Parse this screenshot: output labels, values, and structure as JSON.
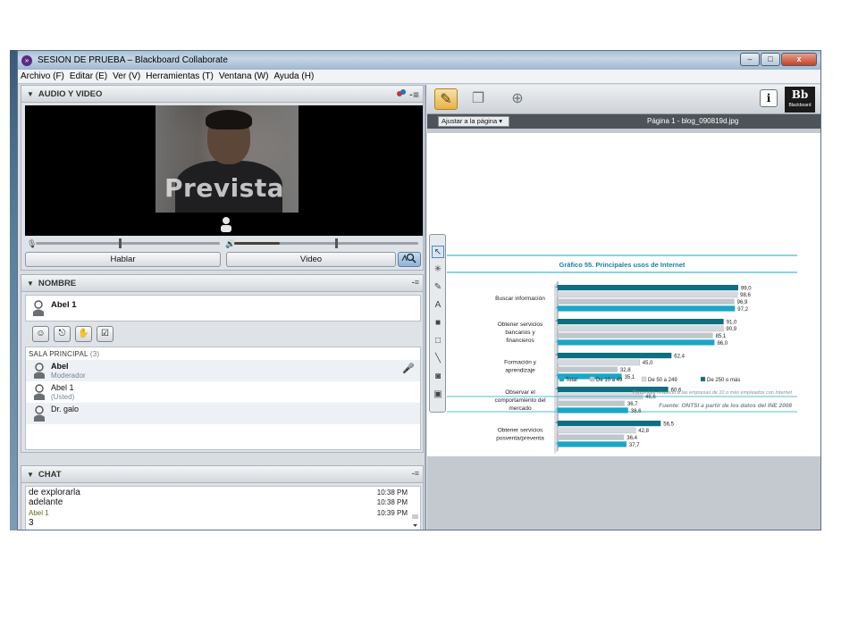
{
  "window": {
    "title": "SESION DE PRUEBA – Blackboard Collaborate",
    "controls": [
      "–",
      "□",
      "x"
    ]
  },
  "menu": [
    "Archivo (F)",
    "Editar (E)",
    "Ver (V)",
    "Herramientas (T)",
    "Ventana (W)",
    "Ayuda (H)"
  ],
  "audio_video": {
    "header": "AUDIO Y VIDEO",
    "overlay_text": "Prevista",
    "talk_button": "Hablar",
    "video_button": "Video",
    "mic_level": 0.45,
    "speaker_level": 0.55
  },
  "names": {
    "header": "NOMBRE",
    "me": "Abel 1",
    "room_label": "SALA PRINCIPAL",
    "room_count": "(3)",
    "participants": [
      {
        "name": "Abel",
        "status": "Moderador"
      },
      {
        "name": "Abel 1",
        "status": "(Usted)"
      },
      {
        "name": "Dr. galo",
        "status": ""
      }
    ]
  },
  "chat": {
    "header": "CHAT",
    "lines": [
      {
        "text": "de explorarla",
        "time": "10:38 PM"
      },
      {
        "text": "adelante",
        "time": "10:38 PM"
      },
      {
        "author": "Abel 1",
        "text": "3",
        "time": "10:39 PM"
      }
    ]
  },
  "whiteboard": {
    "fit_label": "Ajustar a la página",
    "page_label": "Página 1 - blog_090819d.jpg",
    "bb_text": "Bb",
    "bb_word": "Blackboard",
    "info_label": "i"
  },
  "colors": {
    "accent": "#e7b24a",
    "series": [
      "#1aa7c7",
      "#bfc6cc",
      "#e4eef3",
      "#0d6f80"
    ]
  },
  "chart_data": {
    "type": "bar",
    "orientation": "horizontal",
    "title": "Gráfico 55. Principales usos de Internet",
    "categories": [
      "Buscar información",
      "Obtener servicios bancarios y financieros",
      "Formación y aprendizaje",
      "Observar el comportamiento del mercado",
      "Obtener servicios posventa/preventa"
    ],
    "category_lines": [
      [
        "Buscar información"
      ],
      [
        "Obtener servicios",
        "bancarios y",
        "financieros"
      ],
      [
        "Formación y",
        "aprendizaje"
      ],
      [
        "Observar el",
        "comportamiento del",
        "mercado"
      ],
      [
        "Obtener servicios",
        "posventa/preventa"
      ]
    ],
    "series": [
      {
        "name": "De 250 o más",
        "values": [
          99.0,
          91.0,
          62.4,
          60.6,
          56.5
        ]
      },
      {
        "name": "De 50 a 249",
        "values": [
          98.6,
          90.9,
          45.0,
          46.6,
          42.8
        ]
      },
      {
        "name": "De 10 a 49",
        "values": [
          96.9,
          85.1,
          32.8,
          36.7,
          36.4
        ]
      },
      {
        "name": "Total",
        "values": [
          97.2,
          86.0,
          35.1,
          38.6,
          37.7
        ]
      }
    ],
    "value_labels": [
      [
        "99,0",
        "98,6",
        "96,9",
        "97,2"
      ],
      [
        "91,0",
        "90,9",
        "85,1",
        "86,0"
      ],
      [
        "62,4",
        "45,0",
        "32,8",
        "35,1"
      ],
      [
        "60,6",
        "46,6",
        "36,7",
        "38,6"
      ],
      [
        "56,5",
        "42,8",
        "36,4",
        "37,7"
      ]
    ],
    "legend": [
      "Total",
      "De 10 a 49",
      "De 50 a 249",
      "De 250 o más"
    ],
    "note": "Porcentaje respecto a las empresas de 10 o más empleados con Internet",
    "source": "Fuente: ONTSI a partir de los datos del INE 2008",
    "xlim": [
      0,
      100
    ]
  }
}
